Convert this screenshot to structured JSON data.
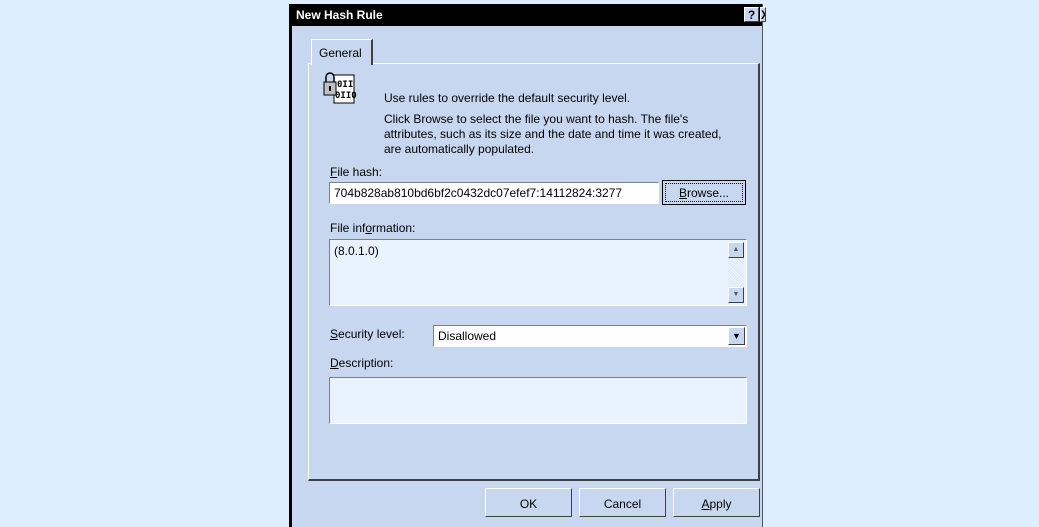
{
  "window": {
    "title": "New Hash Rule",
    "help_glyph": "?",
    "close_glyph": "X"
  },
  "tabs": [
    {
      "label": "General"
    }
  ],
  "intro": {
    "icon": "binary-file-icon",
    "line1": "Use rules to override the default security level.",
    "line2": "Click Browse to select the file you want to hash. The file's",
    "line3": "attributes, such as its size and the date and time it was created,",
    "line4": "are automatically populated."
  },
  "file_hash": {
    "label_key": "F",
    "label_rest": "ile hash:",
    "value": "704b828ab810bd6bf2c0432dc07efef7:14112824:3277",
    "browse_label_key": "B",
    "browse_label_rest": "rowse..."
  },
  "file_info": {
    "label_pre": "File inf",
    "label_key": "o",
    "label_rest": "rmation:",
    "value": "(8.0.1.0)"
  },
  "security_level": {
    "label_key": "S",
    "label_rest": "ecurity level:",
    "selected": "Disallowed"
  },
  "description": {
    "label_key": "D",
    "label_rest": "escription:",
    "value": ""
  },
  "footer": {
    "ok": "OK",
    "cancel": "Cancel",
    "apply_key": "A",
    "apply_rest": "pply"
  },
  "colors": {
    "page_background": "#ddeeff",
    "dialog_face": "#c6d7ef",
    "title_bar": "#000000"
  }
}
